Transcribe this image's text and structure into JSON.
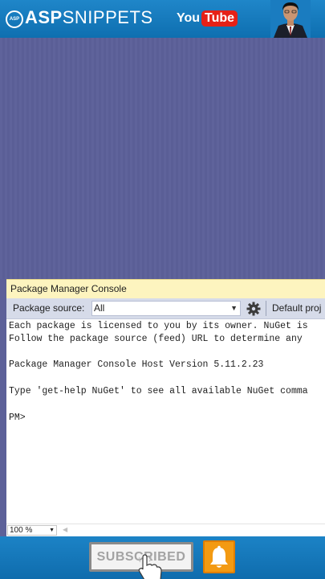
{
  "banner": {
    "logo_badge": "ASP",
    "logo_bold": "ASP",
    "logo_rest": "SNIPPETS",
    "youtube_you": "You",
    "youtube_tube": "Tube",
    "avatar_icon": "presenter-avatar-icon"
  },
  "console": {
    "title": "Package Manager Console",
    "source_label": "Package source:",
    "source_value": "All",
    "settings_icon": "gear-icon",
    "project_label": "Default proj",
    "lines": [
      "Each package is licensed to you by its owner. NuGet is",
      "Follow the package source (feed) URL to determine any",
      "Package Manager Console Host Version 5.11.2.23",
      "Type 'get-help NuGet' to see all available NuGet comma",
      "PM>"
    ],
    "zoom": "100 %"
  },
  "bottom": {
    "subscribe_label": "SUBSCRIBED",
    "bell_icon": "bell-icon",
    "hand_icon": "pointer-hand-icon"
  },
  "colors": {
    "banner_blue": "#1478bb",
    "editor_bg": "#5d6199",
    "console_title_bg": "#fdf4bf",
    "toolbar_bg": "#d6dbe9",
    "bell_orange": "#f39a12"
  }
}
